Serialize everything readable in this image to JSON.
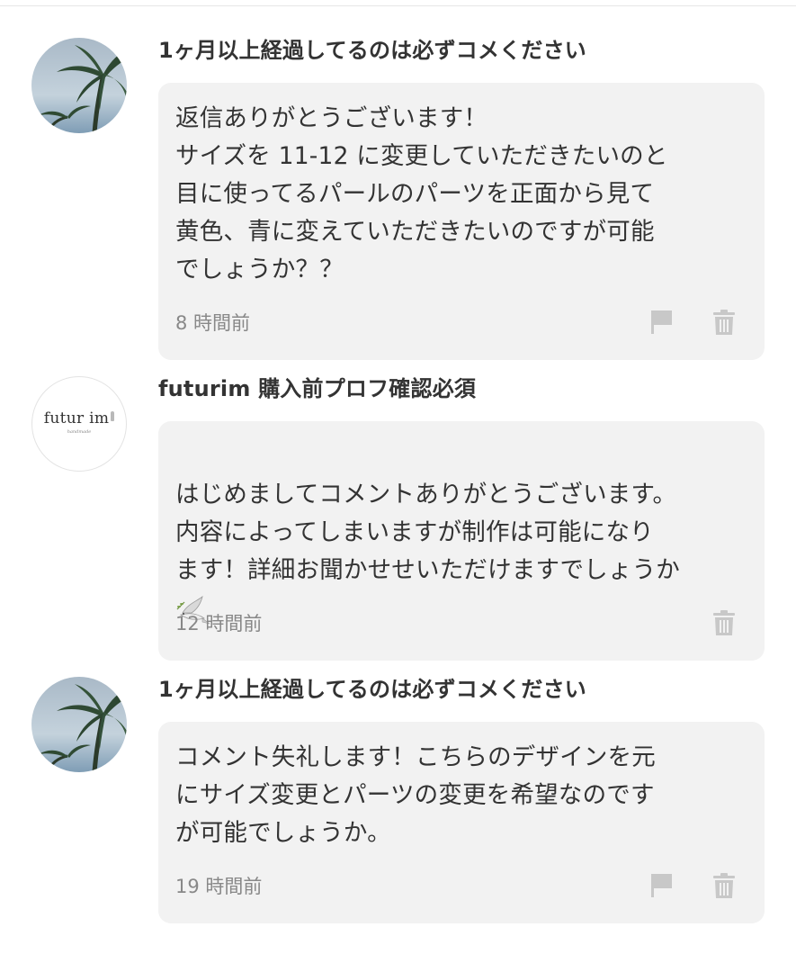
{
  "comments": [
    {
      "username": "1ヶ月以上経過してるのは必ずコメください",
      "avatar": "palm-tree-photo",
      "body": "返信ありがとうございます！\nサイズを 11-12 に変更していただきたいのと\n目に使ってるパールのパーツを正面から見て\n黄色、青に変えていただきたいのですが可能\nでしょうか？？",
      "time": "8 時間前",
      "actions": [
        "flag-icon",
        "trash-icon"
      ]
    },
    {
      "username": "futurim 購入前プロフ確認必須",
      "avatar": "shop-logo",
      "logo_text": "futur im",
      "logo_sub": "handmade",
      "body": "はじめましてコメントありがとうございます。\n内容によってしまいますが制作は可能になり\nます！詳細お聞かせせいただけますでしょうか",
      "emoji": "dove-icon",
      "time": "12 時間前",
      "actions": [
        "trash-icon"
      ]
    },
    {
      "username": "1ヶ月以上経過してるのは必ずコメください",
      "avatar": "palm-tree-photo",
      "body": "コメント失礼します！こちらのデザインを元\nにサイズ変更とパーツの変更を希望なのです\nが可能でしょうか。",
      "time": "19 時間前",
      "actions": [
        "flag-icon",
        "trash-icon"
      ]
    }
  ],
  "colors": {
    "bubble": "#f2f2f2",
    "text": "#333333",
    "muted": "#888888",
    "icon": "#c8c8c8"
  }
}
